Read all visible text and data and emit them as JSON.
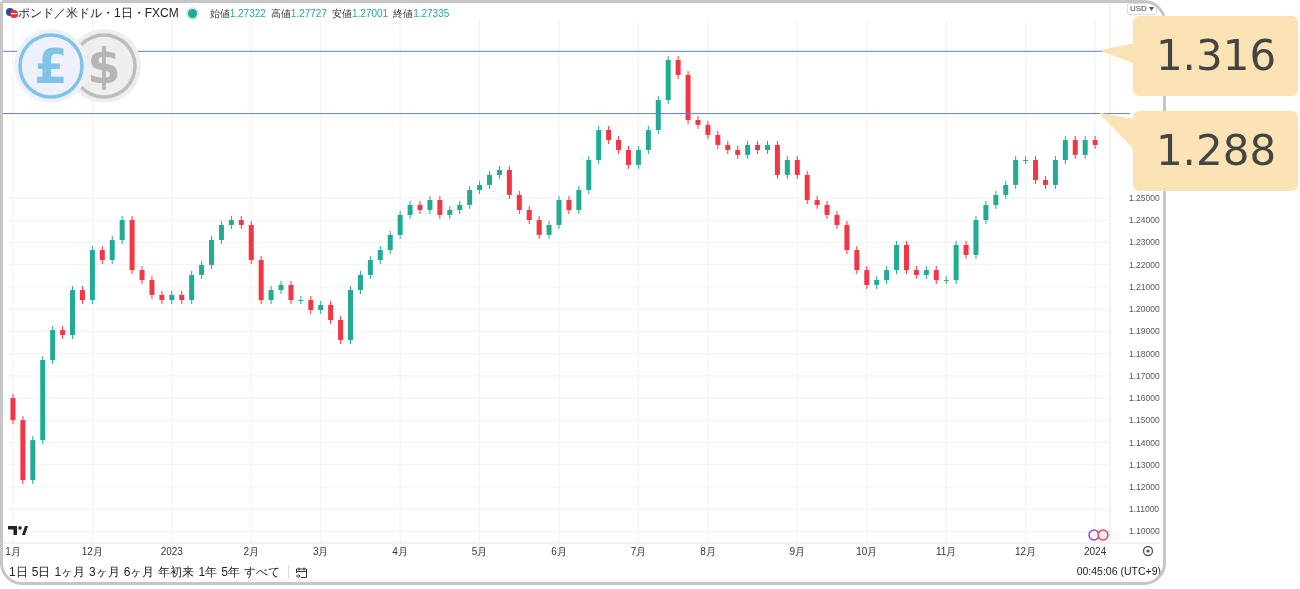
{
  "header": {
    "symbol": "ポンド／米ドル・1日・FXCM",
    "market_open": true,
    "ohlc": [
      {
        "label": "始値",
        "value": "1.27322"
      },
      {
        "label": "高値",
        "value": "1.27727"
      },
      {
        "label": "安値",
        "value": "1.27001"
      },
      {
        "label": "終値",
        "value": "1.27335"
      }
    ]
  },
  "coins": [
    "£",
    "$"
  ],
  "currency": "USD",
  "chart": {
    "chart_data": {
      "type": "candlestick",
      "grid": true,
      "ylim": [
        1.0948,
        1.3301
      ],
      "categories": [
        "1月",
        null,
        null,
        null,
        null,
        null,
        null,
        null,
        "12月",
        null,
        null,
        null,
        null,
        null,
        null,
        null,
        "2023",
        null,
        null,
        null,
        null,
        null,
        null,
        null,
        "2月",
        null,
        null,
        null,
        null,
        null,
        null,
        "3月",
        null,
        null,
        null,
        null,
        null,
        null,
        null,
        "4月",
        null,
        null,
        null,
        null,
        null,
        null,
        null,
        "5月",
        null,
        null,
        null,
        null,
        null,
        null,
        null,
        "6月",
        null,
        null,
        null,
        null,
        null,
        null,
        null,
        "7月",
        null,
        null,
        null,
        null,
        null,
        null,
        "8月",
        null,
        null,
        null,
        null,
        null,
        null,
        null,
        null,
        "9月",
        null,
        null,
        null,
        null,
        null,
        null,
        "10月",
        null,
        null,
        null,
        null,
        null,
        null,
        null,
        "11月",
        null,
        null,
        null,
        null,
        null,
        null,
        null,
        "12月",
        null,
        null,
        null,
        null,
        null,
        null,
        "2024"
      ],
      "ohlc": [
        [
          1.16,
          1.1618,
          1.1483,
          1.1501
        ],
        [
          1.1501,
          1.1519,
          1.1213,
          1.1231
        ],
        [
          1.1231,
          1.1429,
          1.1213,
          1.1411
        ],
        [
          1.1411,
          1.1789,
          1.1393,
          1.1771
        ],
        [
          1.1771,
          1.1924,
          1.1753,
          1.1906
        ],
        [
          1.1906,
          1.1924,
          1.1866,
          1.1884
        ],
        [
          1.1884,
          1.2104,
          1.1866,
          1.2086
        ],
        [
          1.2086,
          1.2104,
          1.2023,
          1.2041
        ],
        [
          1.2041,
          1.2284,
          1.2023,
          1.2266
        ],
        [
          1.2266,
          1.2284,
          1.2203,
          1.2221
        ],
        [
          1.2221,
          1.2329,
          1.2203,
          1.2311
        ],
        [
          1.2311,
          1.2419,
          1.2293,
          1.2401
        ],
        [
          1.2401,
          1.2419,
          1.2158,
          1.2176
        ],
        [
          1.2176,
          1.2194,
          1.2113,
          1.2131
        ],
        [
          1.2131,
          1.2149,
          1.2046,
          1.2064
        ],
        [
          1.2064,
          1.2082,
          1.2023,
          1.2041
        ],
        [
          1.2041,
          1.2082,
          1.2023,
          1.2064
        ],
        [
          1.2064,
          1.2082,
          1.2023,
          1.2041
        ],
        [
          1.2041,
          1.2172,
          1.2023,
          1.2154
        ],
        [
          1.2154,
          1.2217,
          1.2136,
          1.2199
        ],
        [
          1.2199,
          1.2329,
          1.2181,
          1.2311
        ],
        [
          1.2311,
          1.2397,
          1.2293,
          1.2379
        ],
        [
          1.2379,
          1.2419,
          1.2361,
          1.2401
        ],
        [
          1.2401,
          1.2419,
          1.2361,
          1.2379
        ],
        [
          1.2379,
          1.2397,
          1.2203,
          1.2221
        ],
        [
          1.2221,
          1.2239,
          1.2023,
          1.2041
        ],
        [
          1.2041,
          1.2104,
          1.2023,
          1.2086
        ],
        [
          1.2086,
          1.2127,
          1.2068,
          1.2109
        ],
        [
          1.2109,
          1.2127,
          1.2023,
          1.2041
        ],
        [
          1.2041,
          1.2059,
          1.2023,
          1.2041
        ],
        [
          1.2041,
          1.2059,
          1.1978,
          1.1996
        ],
        [
          1.1996,
          1.2037,
          1.1978,
          1.2019
        ],
        [
          1.2019,
          1.2037,
          1.1933,
          1.1951
        ],
        [
          1.1951,
          1.1969,
          1.1843,
          1.1861
        ],
        [
          1.1861,
          1.2104,
          1.1843,
          1.2086
        ],
        [
          1.2086,
          1.2172,
          1.2068,
          1.2154
        ],
        [
          1.2154,
          1.2239,
          1.2136,
          1.2221
        ],
        [
          1.2221,
          1.2284,
          1.2203,
          1.2266
        ],
        [
          1.2266,
          1.2352,
          1.2248,
          1.2334
        ],
        [
          1.2334,
          1.2442,
          1.2316,
          1.2424
        ],
        [
          1.2424,
          1.2487,
          1.2406,
          1.2469
        ],
        [
          1.2469,
          1.2487,
          1.2428,
          1.2446
        ],
        [
          1.2446,
          1.2509,
          1.2428,
          1.2491
        ],
        [
          1.2491,
          1.2509,
          1.2406,
          1.2424
        ],
        [
          1.2424,
          1.2464,
          1.2406,
          1.2446
        ],
        [
          1.2446,
          1.2487,
          1.2428,
          1.2469
        ],
        [
          1.2469,
          1.2554,
          1.2451,
          1.2536
        ],
        [
          1.2536,
          1.2577,
          1.2518,
          1.2559
        ],
        [
          1.2559,
          1.2622,
          1.2541,
          1.2604
        ],
        [
          1.2604,
          1.2644,
          1.2586,
          1.2626
        ],
        [
          1.2626,
          1.2644,
          1.2496,
          1.2514
        ],
        [
          1.2514,
          1.2532,
          1.2428,
          1.2446
        ],
        [
          1.2446,
          1.2464,
          1.2383,
          1.2401
        ],
        [
          1.2401,
          1.2419,
          1.2316,
          1.2334
        ],
        [
          1.2334,
          1.2397,
          1.2316,
          1.2379
        ],
        [
          1.2379,
          1.2509,
          1.2361,
          1.2491
        ],
        [
          1.2491,
          1.2509,
          1.2428,
          1.2446
        ],
        [
          1.2446,
          1.2554,
          1.2428,
          1.2536
        ],
        [
          1.2536,
          1.2689,
          1.2518,
          1.2671
        ],
        [
          1.2671,
          1.2824,
          1.2653,
          1.2806
        ],
        [
          1.2806,
          1.2824,
          1.2743,
          1.2761
        ],
        [
          1.2761,
          1.2779,
          1.2698,
          1.2716
        ],
        [
          1.2716,
          1.2734,
          1.2631,
          1.2649
        ],
        [
          1.2649,
          1.2734,
          1.2631,
          1.2716
        ],
        [
          1.2716,
          1.2824,
          1.2698,
          1.2806
        ],
        [
          1.2806,
          1.2959,
          1.2788,
          1.2941
        ],
        [
          1.2941,
          1.3139,
          1.2923,
          1.3121
        ],
        [
          1.3121,
          1.3139,
          1.3036,
          1.3054
        ],
        [
          1.3054,
          1.3072,
          1.2833,
          1.2851
        ],
        [
          1.2851,
          1.2869,
          1.2811,
          1.2829
        ],
        [
          1.2829,
          1.2847,
          1.2766,
          1.2784
        ],
        [
          1.2784,
          1.2802,
          1.2721,
          1.2739
        ],
        [
          1.2739,
          1.2757,
          1.2698,
          1.2716
        ],
        [
          1.2716,
          1.2734,
          1.2676,
          1.2694
        ],
        [
          1.2694,
          1.2757,
          1.2676,
          1.2739
        ],
        [
          1.2739,
          1.2757,
          1.2698,
          1.2716
        ],
        [
          1.2716,
          1.2757,
          1.2698,
          1.2739
        ],
        [
          1.2739,
          1.2757,
          1.2586,
          1.2604
        ],
        [
          1.2604,
          1.2689,
          1.2586,
          1.2671
        ],
        [
          1.2671,
          1.2689,
          1.2586,
          1.2604
        ],
        [
          1.2604,
          1.2622,
          1.2473,
          1.2491
        ],
        [
          1.2491,
          1.2509,
          1.2451,
          1.2469
        ],
        [
          1.2469,
          1.2487,
          1.2406,
          1.2424
        ],
        [
          1.2424,
          1.2442,
          1.2361,
          1.2379
        ],
        [
          1.2379,
          1.2397,
          1.2248,
          1.2266
        ],
        [
          1.2266,
          1.2284,
          1.2158,
          1.2176
        ],
        [
          1.2176,
          1.2194,
          1.2091,
          1.2109
        ],
        [
          1.2109,
          1.2149,
          1.2091,
          1.2131
        ],
        [
          1.2131,
          1.2194,
          1.2113,
          1.2176
        ],
        [
          1.2176,
          1.2307,
          1.2158,
          1.2289
        ],
        [
          1.2289,
          1.2307,
          1.2158,
          1.2176
        ],
        [
          1.2176,
          1.2194,
          1.2136,
          1.2154
        ],
        [
          1.2154,
          1.2194,
          1.2136,
          1.2176
        ],
        [
          1.2176,
          1.2194,
          1.2113,
          1.2131
        ],
        [
          1.2131,
          1.2149,
          1.2113,
          1.2131
        ],
        [
          1.2131,
          1.2307,
          1.2113,
          1.2289
        ],
        [
          1.2289,
          1.2307,
          1.2226,
          1.2244
        ],
        [
          1.2244,
          1.2419,
          1.2226,
          1.2401
        ],
        [
          1.2401,
          1.2487,
          1.2383,
          1.2469
        ],
        [
          1.2469,
          1.2532,
          1.2451,
          1.2514
        ],
        [
          1.2514,
          1.2577,
          1.2496,
          1.2559
        ],
        [
          1.2559,
          1.2689,
          1.2541,
          1.2671
        ],
        [
          1.2671,
          1.2689,
          1.2653,
          1.2671
        ],
        [
          1.2671,
          1.2689,
          1.2563,
          1.2581
        ],
        [
          1.2581,
          1.2599,
          1.2541,
          1.2559
        ],
        [
          1.2559,
          1.2689,
          1.2541,
          1.2671
        ],
        [
          1.2671,
          1.2779,
          1.2653,
          1.2761
        ],
        [
          1.2761,
          1.2779,
          1.2676,
          1.2694
        ],
        [
          1.2694,
          1.2779,
          1.2676,
          1.2761
        ],
        [
          1.2761,
          1.2779,
          1.2721,
          1.2739
        ]
      ],
      "yticks": [
        {
          "value": 1.25,
          "label": "1.25000"
        },
        {
          "value": 1.24,
          "label": "1.24000"
        },
        {
          "value": 1.23,
          "label": "1.23000"
        },
        {
          "value": 1.22,
          "label": "1.22000"
        },
        {
          "value": 1.21,
          "label": "1.21000"
        },
        {
          "value": 1.2,
          "label": "1.20000"
        },
        {
          "value": 1.19,
          "label": "1.19000"
        },
        {
          "value": 1.18,
          "label": "1.18000"
        },
        {
          "value": 1.17,
          "label": "1.17000"
        },
        {
          "value": 1.16,
          "label": "1.16000"
        },
        {
          "value": 1.15,
          "label": "1.15000"
        },
        {
          "value": 1.14,
          "label": "1.14000"
        },
        {
          "value": 1.13,
          "label": "1.13000"
        },
        {
          "value": 1.12,
          "label": "1.12000"
        },
        {
          "value": 1.11,
          "label": "1.11000"
        },
        {
          "value": 1.1,
          "label": "1.10000"
        }
      ],
      "ref_lines": [
        {
          "axis": "y",
          "value": 1.316,
          "label": "1.316"
        },
        {
          "axis": "y",
          "value": 1.288,
          "label": "1.288"
        }
      ]
    }
  },
  "ranges": [
    "1日",
    "5日",
    "1ヶ月",
    "3ヶ月",
    "6ヶ月",
    "年初来",
    "1年",
    "5年",
    "すべて"
  ],
  "time": "00:45:06 (UTC+9)"
}
